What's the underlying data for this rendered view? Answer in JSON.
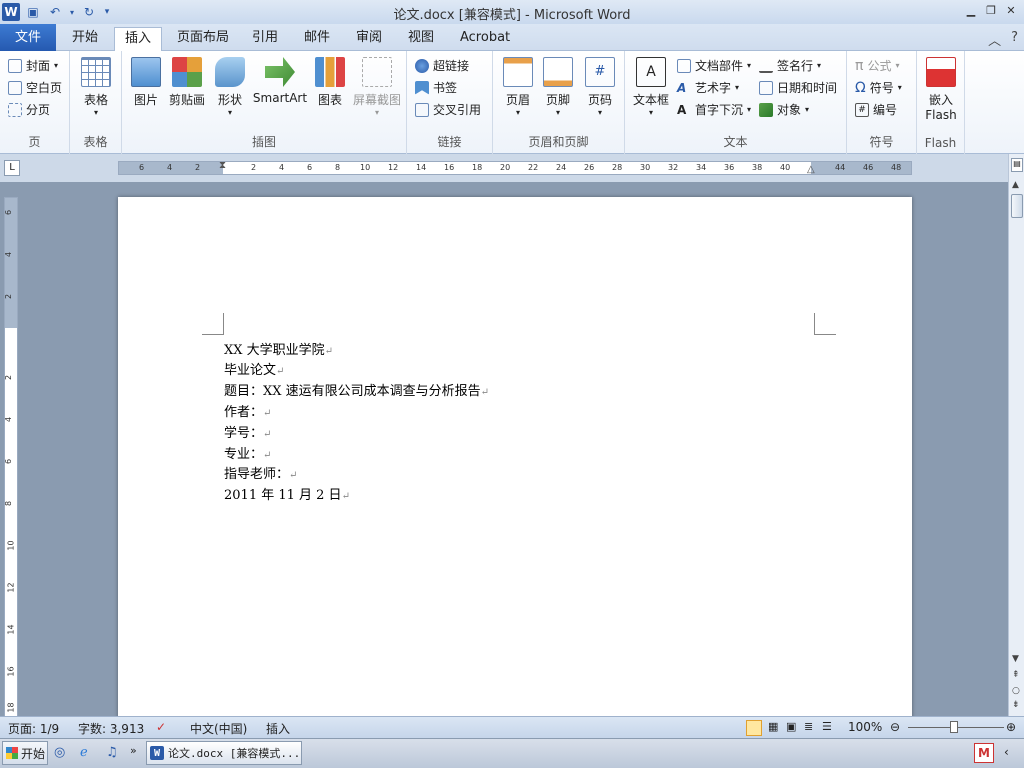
{
  "window": {
    "title": "论文.docx [兼容模式]  -  Microsoft Word"
  },
  "tabs": [
    {
      "label": "文件"
    },
    {
      "label": "开始"
    },
    {
      "label": "插入"
    },
    {
      "label": "页面布局"
    },
    {
      "label": "引用"
    },
    {
      "label": "邮件"
    },
    {
      "label": "审阅"
    },
    {
      "label": "视图"
    },
    {
      "label": "Acrobat"
    }
  ],
  "ribbon": {
    "page": {
      "label": "页",
      "items": [
        "封面",
        "空白页",
        "分页"
      ]
    },
    "table": {
      "label": "表格",
      "button": "表格"
    },
    "illustrations": {
      "label": "插图",
      "buttons": [
        "图片",
        "剪贴画",
        "形状",
        "SmartArt",
        "图表",
        "屏幕截图"
      ]
    },
    "links": {
      "label": "链接",
      "items": [
        "超链接",
        "书签",
        "交叉引用"
      ]
    },
    "headerfooter": {
      "label": "页眉和页脚",
      "buttons": [
        "页眉",
        "页脚",
        "页码"
      ]
    },
    "text": {
      "label": "文本",
      "textbox": "文本框",
      "items": [
        "文档部件",
        "艺术字",
        "首字下沉",
        "签名行",
        "日期和时间",
        "对象"
      ]
    },
    "symbols": {
      "label": "符号",
      "items": [
        "公式",
        "符号",
        "编号"
      ]
    },
    "flash": {
      "label": "Flash",
      "button1": "嵌入",
      "button2": "Flash"
    }
  },
  "ruler": {
    "ticks": [
      "6",
      "4",
      "2",
      "2",
      "4",
      "6",
      "8",
      "10",
      "12",
      "14",
      "16",
      "18",
      "20",
      "22",
      "24",
      "26",
      "28",
      "30",
      "32",
      "34",
      "36",
      "38",
      "40",
      "44",
      "46",
      "48"
    ]
  },
  "vruler": {
    "ticks": [
      "6",
      "4",
      "2",
      "2",
      "4",
      "6",
      "8",
      "10",
      "12",
      "14",
      "16",
      "18"
    ]
  },
  "document": {
    "lines": [
      "XX 大学职业学院",
      "毕业论文",
      "题目：XX 速运有限公司成本调查与分析报告",
      "作者：",
      "学号：",
      "专业：",
      "指导老师：",
      "2011 年 11 月 2 日"
    ],
    "para_mark": "↵"
  },
  "status": {
    "page": "页面: 1/9",
    "words": "字数: 3,913",
    "lang": "中文(中国)",
    "mode": "插入",
    "zoom": "100%"
  },
  "taskbar": {
    "start": "开始",
    "task": "论文.docx [兼容模式..."
  }
}
